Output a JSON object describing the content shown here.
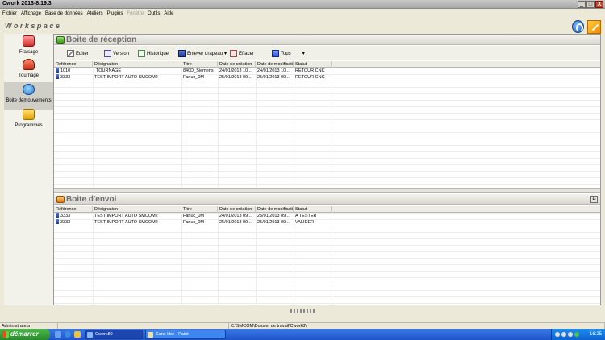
{
  "window": {
    "title": "Cwork 2013-8.19.3",
    "min": "_",
    "max": "□",
    "close": "X"
  },
  "menu": [
    "Fichier",
    "Affichage",
    "Base de données",
    "Ateliers",
    "Plugins",
    "Fenêtre",
    "Outils",
    "Aide"
  ],
  "workspace_title": "Workspace",
  "sidebar": [
    {
      "label": "Fraisage",
      "icon": "fraisage-icon"
    },
    {
      "label": "Tournage",
      "icon": "tournage-icon"
    },
    {
      "label": "Boite demouvements",
      "icon": "boite-icon",
      "selected": true
    },
    {
      "label": "Programmes",
      "icon": "programmes-icon"
    }
  ],
  "inbox": {
    "title": "Boite de réception",
    "toolbar": {
      "editer": "Editer",
      "version": "Version",
      "historique": "Historique",
      "enlever": "Enlever drapeau",
      "effacer": "Effacer",
      "tous": "Tous"
    },
    "columns": [
      "Référence",
      "Désignation",
      "Titre",
      "Date de création",
      "Date de modification",
      "Statut"
    ],
    "rows": [
      [
        "1010",
        "TOURNAGE",
        "840D_Siemens",
        "24/01/2013 10...",
        "24/01/2013 10...",
        "RETOUR CNC"
      ],
      [
        "3333",
        "TEST IMPORT AUTO SMCOM2",
        "Fanuc_0M",
        "25/01/2013 09...",
        "25/01/2013 09...",
        "RETOUR CNC"
      ]
    ]
  },
  "outbox": {
    "title": "Boite d'envoi",
    "columns": [
      "Référence",
      "Désignation",
      "Titre",
      "Date de création",
      "Date de modification",
      "Statut"
    ],
    "rows": [
      [
        "3333",
        "TEST IMPORT AUTO SMCOM2",
        "Fanuc_0M",
        "24/01/2013 09...",
        "25/01/2013 09...",
        "A TESTER"
      ],
      [
        "3333",
        "TEST IMPORT AUTO SMCOM2",
        "Fanuc_0M",
        "25/01/2013 09...",
        "25/01/2013 09...",
        "VALIDER"
      ]
    ]
  },
  "statusbar": {
    "user": "Administrateur",
    "path": "C:\\SMCOM\\Dossier de travail\\Cwork8\\"
  },
  "taskbar": {
    "start": "démarrer",
    "tasks": [
      {
        "label": "Cwork80",
        "active": true
      },
      {
        "label": "Sans titre - Paint",
        "active": false
      }
    ],
    "clock": "16:25"
  },
  "colors": {
    "taskbar": "#1f55c8",
    "start": "#2a8a2a",
    "flag": "#1a3a9a"
  }
}
